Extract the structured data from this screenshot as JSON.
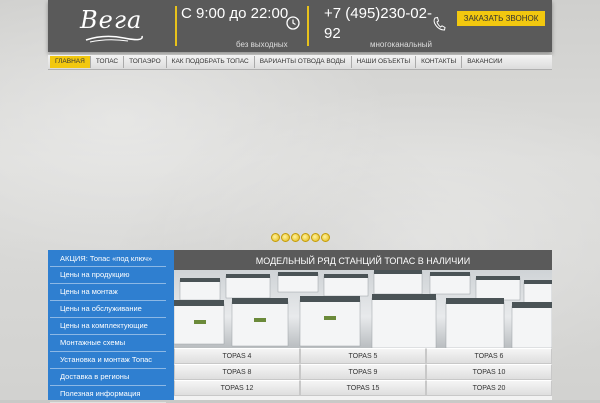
{
  "header": {
    "logo_text": "Вега",
    "hours": "С 9:00 до 22:00",
    "hours_note": "без выходных",
    "phone": "+7 (495)230-02-92",
    "phone_note": "многоканальный",
    "callback_label": "ЗАКАЗАТЬ ЗВОНОК"
  },
  "nav": {
    "items": [
      {
        "label": "ГЛАВНАЯ"
      },
      {
        "label": "ТОПАС"
      },
      {
        "label": "ТОПАЭРО"
      },
      {
        "label": "КАК ПОДОБРАТЬ ТОПАС"
      },
      {
        "label": "ВАРИАНТЫ ОТВОДА ВОДЫ"
      },
      {
        "label": "НАШИ ОБЪЕКТЫ"
      },
      {
        "label": "КОНТАКТЫ"
      },
      {
        "label": "ВАКАНСИИ"
      }
    ]
  },
  "sidebar": {
    "items": [
      {
        "label": "АКЦИЯ: Топас «под ключ»"
      },
      {
        "label": "Цены на продукцию"
      },
      {
        "label": "Цены на монтаж"
      },
      {
        "label": "Цены на обслуживание"
      },
      {
        "label": "Цены на комплектующие"
      },
      {
        "label": "Монтажные схемы"
      },
      {
        "label": "Установка и монтаж Топас"
      },
      {
        "label": "Доставка в регионы"
      },
      {
        "label": "Полезная информация"
      }
    ]
  },
  "panel": {
    "title": "МОДЕЛЬНЫЙ РЯД СТАНЦИЙ ТОПАС В НАЛИЧИИ",
    "models": [
      [
        "TOPAS 4",
        "TOPAS 5",
        "TOPAS 6"
      ],
      [
        "TOPAS 8",
        "TOPAS 9",
        "TOPAS 10"
      ],
      [
        "TOPAS 12",
        "TOPAS 15",
        "TOPAS 20"
      ]
    ]
  },
  "colors": {
    "accent": "#f2c80f",
    "header_bg": "#5a5a5a",
    "sidebar_bg": "#2f7fd0"
  }
}
